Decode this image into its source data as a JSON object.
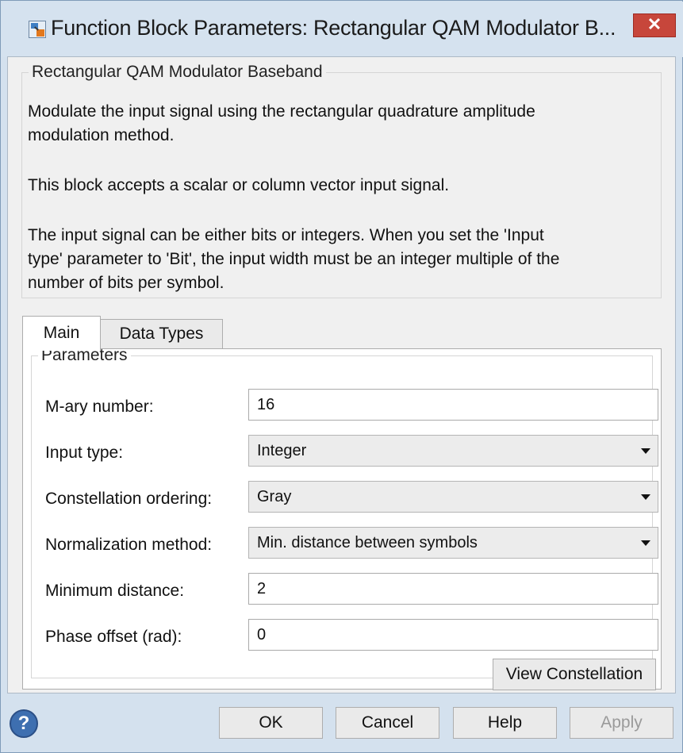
{
  "window": {
    "title": "Function Block Parameters: Rectangular QAM Modulator B...",
    "close_symbol": "✕"
  },
  "description": {
    "group_title": "Rectangular QAM Modulator Baseband",
    "line1": "Modulate the input signal using the rectangular quadrature amplitude",
    "line2": "modulation method.",
    "line3": "This block accepts a scalar or column vector input signal.",
    "line4": "The input signal can be either bits or integers. When you set the 'Input",
    "line5": "type' parameter to 'Bit', the input width must be an integer multiple of the",
    "line6": "number of bits per symbol."
  },
  "tabs": [
    {
      "label": "Main",
      "active": true
    },
    {
      "label": "Data Types",
      "active": false
    }
  ],
  "parameters": {
    "group_title": "Parameters",
    "mary_label": "M-ary number:",
    "mary_value": "16",
    "input_type_label": "Input type:",
    "input_type_value": "Integer",
    "constellation_label": "Constellation ordering:",
    "constellation_value": "Gray",
    "normalization_label": "Normalization method:",
    "normalization_value": "Min. distance between symbols",
    "min_distance_label": "Minimum distance:",
    "min_distance_value": "2",
    "phase_offset_label": "Phase offset (rad):",
    "phase_offset_value": "0",
    "view_constellation_label": "View Constellation"
  },
  "footer": {
    "help_icon": "?",
    "ok_label": "OK",
    "cancel_label": "Cancel",
    "help_label": "Help",
    "apply_label": "Apply"
  },
  "colors": {
    "titlebar": "#d5e2ef",
    "close_button": "#c7463b",
    "help_icon": "#3e6fb0"
  }
}
